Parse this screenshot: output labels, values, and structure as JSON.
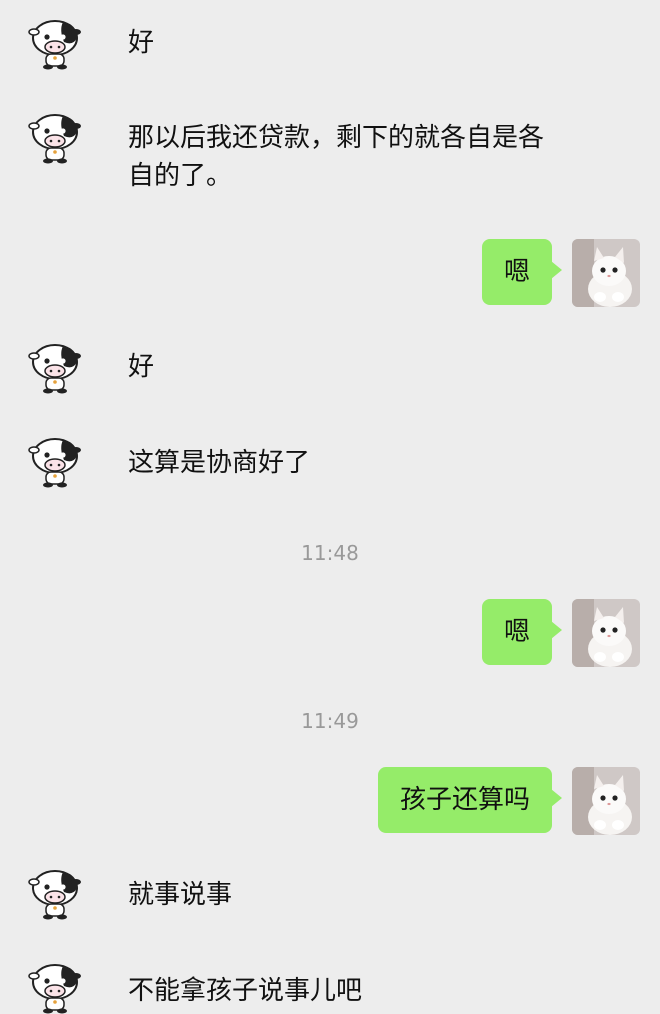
{
  "messages": [
    {
      "side": "in",
      "text": "好"
    },
    {
      "side": "in",
      "text": "那以后我还贷款，剩下的就各自是各自的了。"
    },
    {
      "side": "out",
      "text": "嗯"
    },
    {
      "side": "in",
      "text": "好"
    },
    {
      "side": "in",
      "text": "这算是协商好了"
    },
    {
      "side": "out",
      "text": "嗯"
    },
    {
      "side": "out",
      "text": "孩子还算吗"
    },
    {
      "side": "in",
      "text": "就事说事"
    },
    {
      "side": "in",
      "text": "不能拿孩子说事儿吧"
    }
  ],
  "timestamps": [
    "11:48",
    "11:49"
  ],
  "colors": {
    "background": "#ededed",
    "outgoing_bubble": "#95ec69",
    "timestamp": "#999999"
  },
  "icons": {
    "incoming_avatar": "cow-avatar-icon",
    "outgoing_avatar": "cat-avatar-icon"
  }
}
